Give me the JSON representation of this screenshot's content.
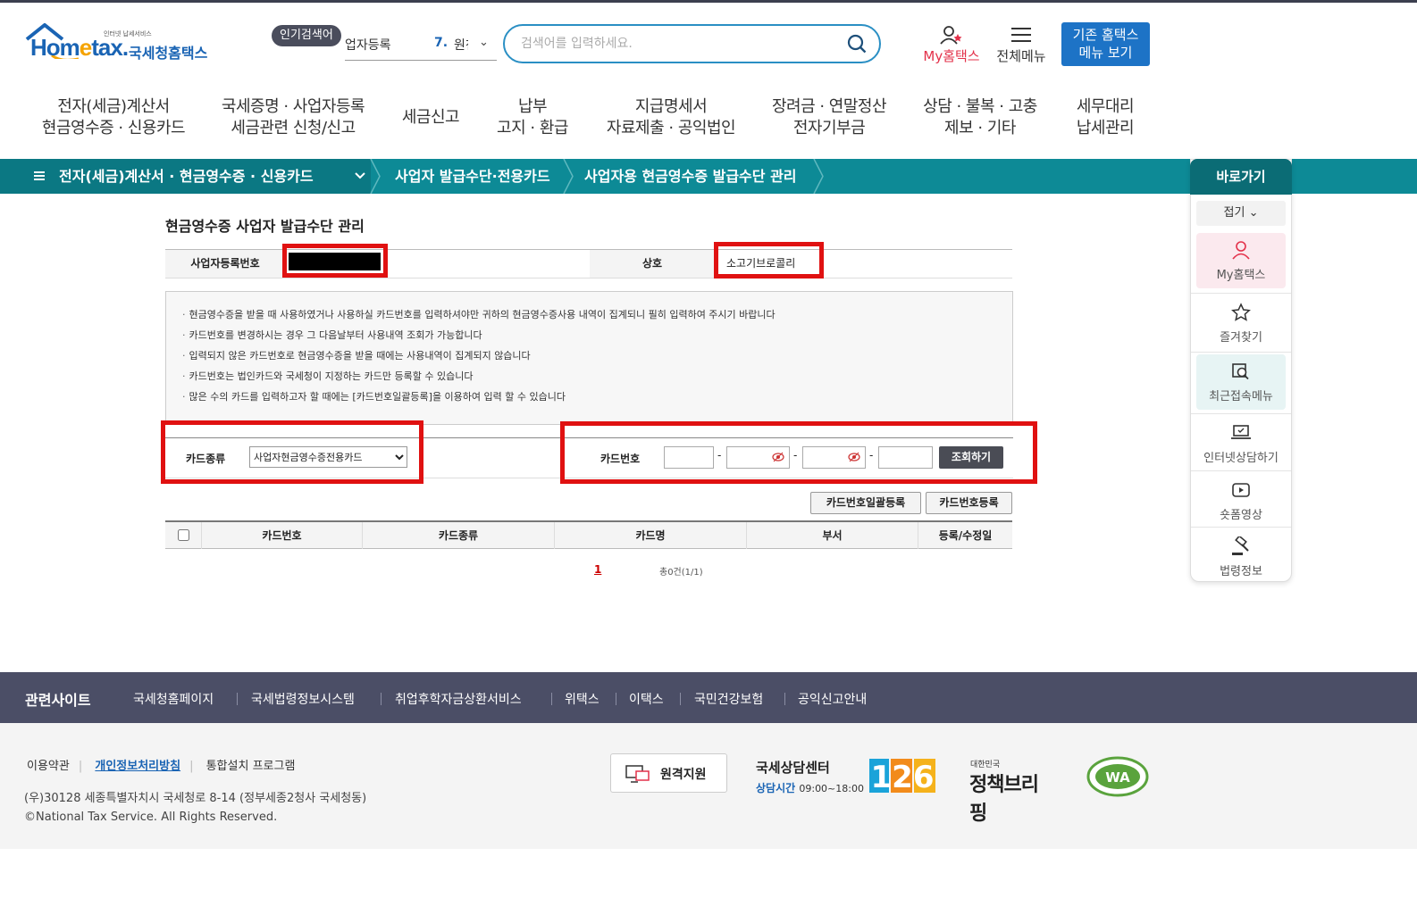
{
  "header": {
    "logo_small": "인터넷 납세서비스",
    "logo_brand_1": "Hom",
    "logo_brand_e": "e",
    "logo_brand_2": "tax.",
    "logo_name": "국세청홈택스",
    "popular_label": "인기검색어",
    "popular_keyword": "업자등록",
    "popular_rank": "7.",
    "popular_next": "원천",
    "search_placeholder": "검색어를 입력하세요.",
    "myhome_label": "My홈택스",
    "allmenu_label": "전체메뉴",
    "oldmenu_line1": "기존 홈택스",
    "oldmenu_line2": "메뉴 보기"
  },
  "gnb": [
    {
      "l1": "전자(세금)계산서",
      "l2": "현금영수증 · 신용카드"
    },
    {
      "l1": "국세증명 · 사업자등록",
      "l2": "세금관련 신청/신고"
    },
    {
      "l1": "세금신고",
      "l2": ""
    },
    {
      "l1": "납부",
      "l2": "고지 · 환급"
    },
    {
      "l1": "지급명세서",
      "l2": "자료제출 · 공익법인"
    },
    {
      "l1": "장려금 · 연말정산",
      "l2": "전자기부금"
    },
    {
      "l1": "상담 · 불복 · 고충",
      "l2": "제보 · 기타"
    },
    {
      "l1": "세무대리",
      "l2": "납세관리"
    }
  ],
  "breadcrumb": {
    "level1": "전자(세금)계산서 · 현금영수증 · 신용카드",
    "level2": "사업자 발급수단·전용카드",
    "level3": "사업자용 현금영수증 발급수단 관리"
  },
  "quick": {
    "title": "바로가기",
    "fold": "접기",
    "items": [
      "My홈택스",
      "즐겨찾기",
      "최근접속메뉴",
      "인터넷상담하기",
      "숏폼영상",
      "법령정보"
    ]
  },
  "page": {
    "title": "현금영수증 사업자 발급수단 관리",
    "biz_no_label": "사업자등록번호",
    "biz_name_label": "상호",
    "biz_name": "소고기브로콜리",
    "guide": [
      "현금영수증을 받을 때 사용하였거나 사용하실 카드번호를 입력하셔야만 귀하의 현금영수증사용 내역이 집계되니 필히 입력하여 주시기 바랍니다",
      "카드번호를 변경하시는 경우 그 다음날부터 사용내역 조회가 가능합니다",
      "입력되지 않은 카드번호로 현금영수증을 받을 때에는 사용내역이 집계되지 않습니다",
      "카드번호는 법인카드와 국세청이 지정하는 카드만 등록할 수 있습니다",
      "많은 수의 카드를 입력하고자 할 때에는 [카드번호일괄등록]을 이용하여 입력 할 수 있습니다"
    ],
    "card_type_label": "카드종류",
    "card_type_value": "사업자현금영수증전용카드",
    "card_no_label": "카드번호",
    "dash": "-",
    "search_button": "조회하기",
    "bulk_button": "카드번호일괄등록",
    "register_button": "카드번호등록",
    "columns": [
      "카드번호",
      "카드종류",
      "카드명",
      "부서",
      "등록/수정일"
    ],
    "page_no": "1",
    "total": "총0건(1/1)"
  },
  "footer": {
    "related": "관련사이트",
    "links": [
      "국세청홈페이지",
      "국세법령정보시스템",
      "취업후학자금상환서비스",
      "위택스",
      "이택스",
      "국민건강보험",
      "공익신고안내"
    ],
    "terms": "이용약관",
    "privacy": "개인정보처리방침",
    "install": "통합설치 프로그램",
    "address": "(우)30128 세종특별자치시 국세청로 8-14 (정부세종2청사 국세청동)",
    "copyright": "©National Tax Service. All Rights Reserved.",
    "remote": "원격지원",
    "center_name": "국세상담센터",
    "center_hours_label": "상담시간",
    "center_hours": "09:00~18:00",
    "center_number": "126",
    "briefing_small": "대한민국",
    "briefing": "정책브리핑",
    "wa_mark": "WA"
  },
  "colors": {
    "brand_blue": "#1a64b4",
    "teal": "#0d8a96",
    "highlight_red": "#e01111",
    "footer_bar": "#4b4e66"
  }
}
